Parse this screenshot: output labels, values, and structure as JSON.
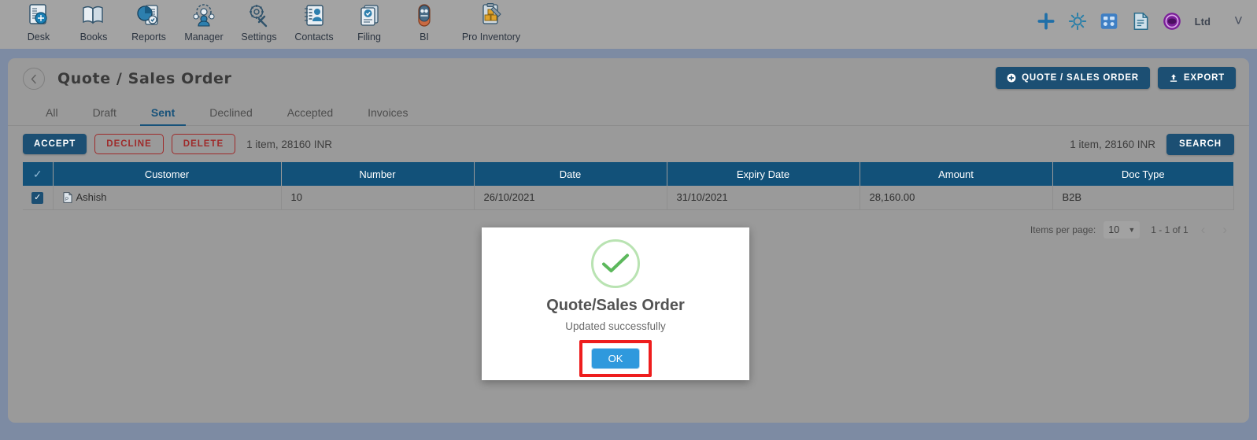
{
  "toolbar": {
    "apps": [
      {
        "label": "Desk",
        "icon": "desk-icon"
      },
      {
        "label": "Books",
        "icon": "books-icon"
      },
      {
        "label": "Reports",
        "icon": "reports-icon"
      },
      {
        "label": "Manager",
        "icon": "manager-icon"
      },
      {
        "label": "Settings",
        "icon": "settings-icon"
      },
      {
        "label": "Contacts",
        "icon": "contacts-icon"
      },
      {
        "label": "Filing",
        "icon": "filing-icon"
      },
      {
        "label": "BI",
        "icon": "bi-icon"
      },
      {
        "label": "Pro Inventory",
        "icon": "pro-inventory-icon"
      }
    ],
    "right_icons": [
      "plus-icon",
      "gear-icon",
      "apps-grid-icon",
      "document-icon",
      "badge-icon"
    ],
    "company": "Ltd",
    "chevron": "˅"
  },
  "page": {
    "title": "Quote / Sales Order",
    "back_label": "‹",
    "actions": {
      "new_label": "QUOTE / SALES ORDER",
      "new_icon": "plus-circle-icon",
      "export_label": "EXPORT",
      "export_icon": "upload-icon"
    }
  },
  "tabs": [
    {
      "label": "All",
      "active": false
    },
    {
      "label": "Draft",
      "active": false
    },
    {
      "label": "Sent",
      "active": true
    },
    {
      "label": "Declined",
      "active": false
    },
    {
      "label": "Accepted",
      "active": false
    },
    {
      "label": "Invoices",
      "active": false
    }
  ],
  "actionbar": {
    "accept_label": "ACCEPT",
    "decline_label": "DECLINE",
    "delete_label": "DELETE",
    "summary_left": "1 item, 28160 INR",
    "summary_right": "1 item, 28160 INR",
    "search_label": "SEARCH"
  },
  "table": {
    "header_check": "✓",
    "columns": [
      "Customer",
      "Number",
      "Date",
      "Expiry Date",
      "Amount",
      "Doc Type"
    ],
    "rows": [
      {
        "selected": true,
        "check_glyph": "✓",
        "customer": "Ashish",
        "customer_icon": "document-icon",
        "number": "10",
        "date": "26/10/2021",
        "expiry_date": "31/10/2021",
        "amount": "28,160.00",
        "doc_type": "B2B"
      }
    ]
  },
  "pagination": {
    "items_per_page_label": "Items per page:",
    "items_per_page_value": "10",
    "caret": "▼",
    "range": "1 - 1 of 1",
    "prev": "‹",
    "next": "›"
  },
  "modal": {
    "icon": "success-check-icon",
    "title": "Quote/Sales Order",
    "message": "Updated successfully",
    "ok_label": "OK"
  },
  "colors": {
    "toolbar_bg": "#a3a3a3",
    "page_bg": "#7d8ba3",
    "card_bg": "#9a9a9a",
    "primary_blue": "#1c4f73",
    "table_header_blue": "#125179",
    "danger_red": "#9e2b2b",
    "highlight_red": "#ee1d1d",
    "ok_blue": "#2f99dd",
    "success_green": "#5cb85c"
  }
}
